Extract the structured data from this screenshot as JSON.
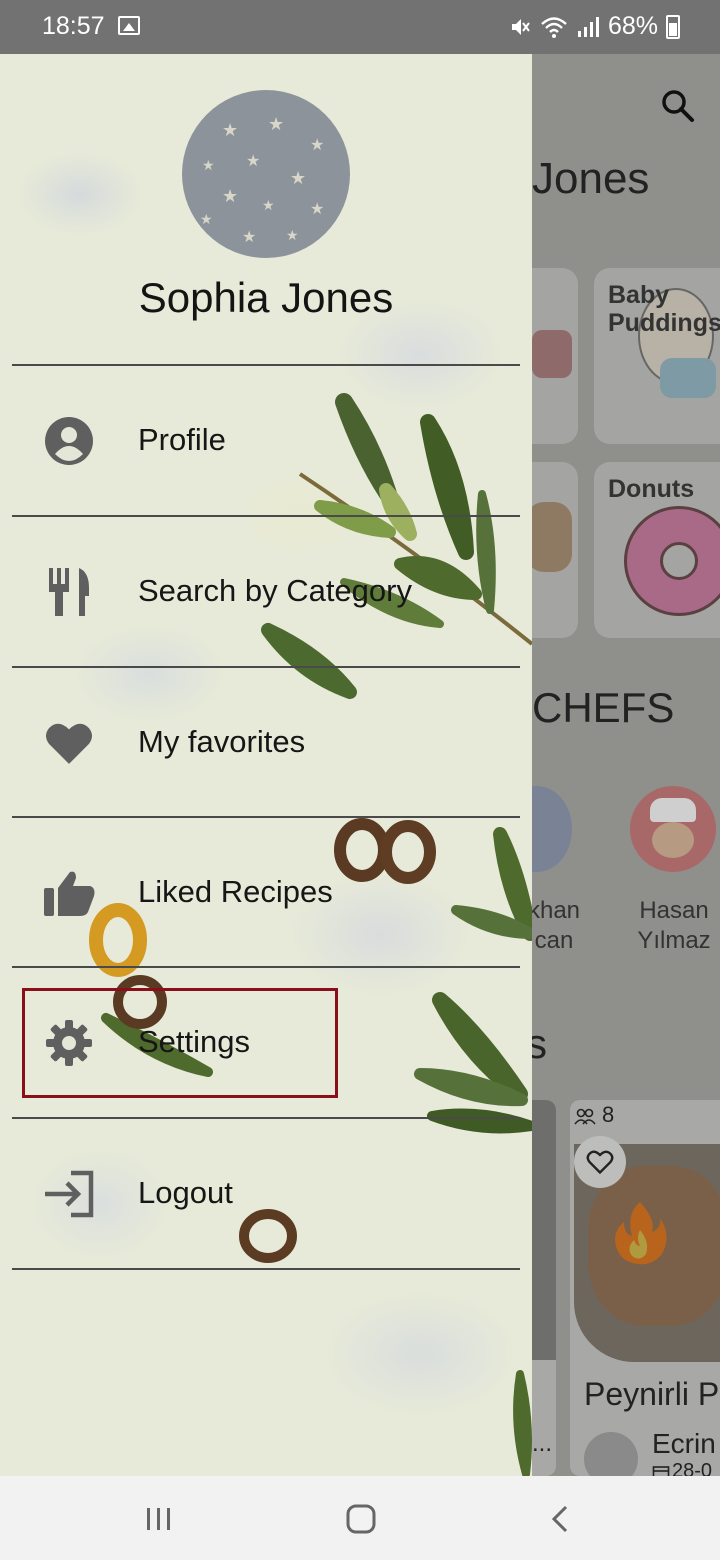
{
  "status_bar": {
    "time": "18:57",
    "battery": "68%",
    "icons": [
      "image-icon",
      "mute-icon",
      "wifi-icon",
      "signal-icon",
      "battery-icon"
    ]
  },
  "drawer": {
    "user_name": "Sophia Jones",
    "menu": [
      {
        "label": "Profile",
        "icon": "account-circle-icon"
      },
      {
        "label": "Search by Category",
        "icon": "fork-knife-icon"
      },
      {
        "label": "My favorites",
        "icon": "heart-icon"
      },
      {
        "label": "Liked Recipes",
        "icon": "thumbs-up-icon"
      },
      {
        "label": "Settings",
        "icon": "gear-icon"
      },
      {
        "label": "Logout",
        "icon": "logout-icon"
      }
    ],
    "highlighted_item": "Settings",
    "highlight_color": "#8a0f1a"
  },
  "background_app": {
    "user_name_partial": "Jones",
    "categories": [
      {
        "label": "Baby\nPuddings"
      },
      {
        "label": "Donuts"
      }
    ],
    "section_title_partial": "CHEFS",
    "chefs": [
      {
        "name": "khan\ncan"
      },
      {
        "name": "Hasan\nYılmaz"
      }
    ],
    "section_partial_letter": "s",
    "recipe": {
      "servings": "8",
      "title": "Peynirli P",
      "author": "Ecrin",
      "date": "28-0",
      "left_ellipsis": "..."
    }
  },
  "nav_bar": {
    "buttons": [
      "recents-button",
      "home-button",
      "back-button"
    ]
  }
}
